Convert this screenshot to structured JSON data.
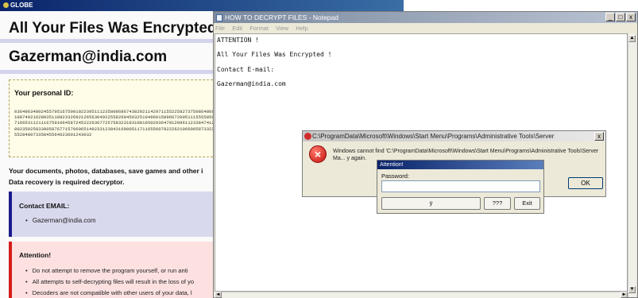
{
  "ransom_page": {
    "window_title": "GLOBE",
    "heading": "All Your Files Was Encrypted !",
    "email_heading": "Gazerman@india.com",
    "personal_id_label": "Your personal ID:",
    "personal_id_code": "0364963480245579516750010223951112358086867438202114297115522582737508648664610874921628035118823326921265636492255826045632519496015896672005111555585052716653112111675910645872452226367725758323193108165029364791209611233847412530023502583300587677157069651492331238431600051171165560792226210660058733227955284807335845564623601243032",
    "docs_line": "Your documents, photos, databases, save games and other i",
    "decryptor_line": "Data recovery is required decryptor.",
    "contact_heading": "Contact EMAIL:",
    "contact_email": "Gazerman@india.com",
    "attention_heading": "Attention!",
    "attention_items": [
      "Do not attempt to remove the program yourself, or run anti",
      "All attempts to self-decrypting files will result in the loss of yo",
      "Decoders are not compatible with other users of your data, l"
    ]
  },
  "notepad": {
    "title": "HOW TO DECRYPT FILES - Notepad",
    "controls": {
      "minimize": "_",
      "maximize": "□",
      "close": "x"
    },
    "menu": [
      "File",
      "Edit",
      "Format",
      "View",
      "Help"
    ],
    "lines": [
      "ATTENTION !",
      "All Your Files Was Encrypted !",
      "Contact E-mail:",
      "Gazerman@india.com"
    ],
    "scroll": {
      "up": "▲",
      "down": "▼",
      "left": "◄",
      "right": "►"
    }
  },
  "error_dialog": {
    "title": "C:\\ProgramData\\Microsoft\\Windows\\Start Menu\\Programs\\Administrative Tools\\Server",
    "close": "x",
    "message": "Windows cannot find 'C:\\ProgramData\\Microsoft\\Windows\\Start Menu\\Programs\\Administrative Tools\\Server Ma... y again.",
    "ok_label": "OK"
  },
  "password_dialog": {
    "title": "Attention!",
    "label": "Password:",
    "value": "",
    "buttons": [
      "ÿ",
      "???",
      "Exit"
    ]
  }
}
